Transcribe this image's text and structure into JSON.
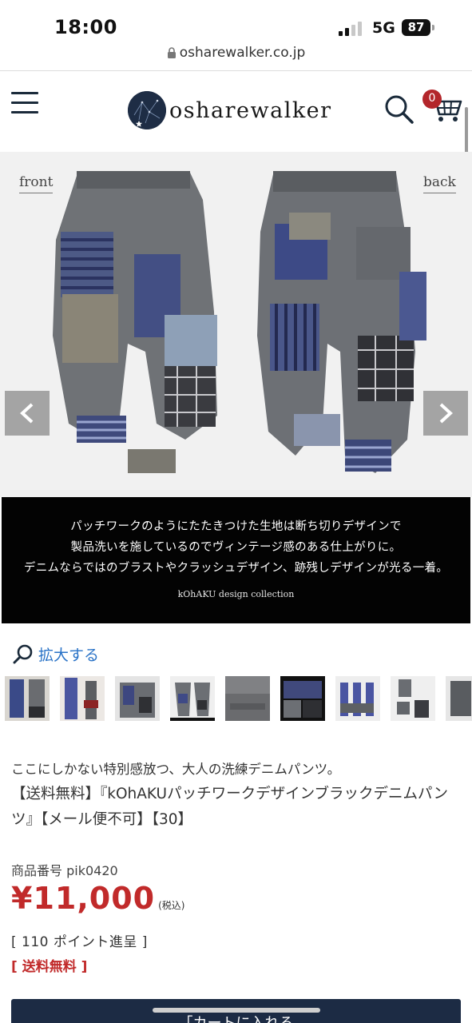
{
  "status_bar": {
    "time": "18:00",
    "network": "5G",
    "battery": "87"
  },
  "browser": {
    "url": "osharewalker.co.jp"
  },
  "header": {
    "logo_text": "osharewalker",
    "cart_count": "0"
  },
  "gallery": {
    "label_front": "front",
    "label_back": "back",
    "banner_lines": [
      "パッチワークのようにたたきつけた生地は断ち切りデザインで",
      "製品洗いを施しているのでヴィンテージ感のある仕上がりに。",
      "デニムならではのブラストやクラッシュデザイン、跡残しデザインが光る一着。"
    ],
    "banner_credit": "kOhAKU design collection",
    "zoom_label": "拡大する"
  },
  "product": {
    "catchcopy": "ここにしかない特別感放つ、大人の洗練デニムパンツ。",
    "title": "【送料無料】『kOhAKUパッチワークデザインブラックデニムパンツ』【メール便不可】【30】",
    "sku": "商品番号 pik0420",
    "price": "¥11,000",
    "tax_note": "(税込)",
    "points": "[ 110 ポイント進呈 ]",
    "free_shipping": "[ 送料無料 ]"
  },
  "cta": {
    "label": "「カートに入れる"
  },
  "colors": {
    "accent_red": "#c12a2a",
    "link_blue": "#2a73c7",
    "navy": "#1c2b44",
    "badge_red": "#b3262b"
  },
  "icons": [
    "menu-icon",
    "search-icon",
    "cart-icon",
    "chevron-left-icon",
    "chevron-right-icon",
    "zoom-icon",
    "lock-icon"
  ]
}
